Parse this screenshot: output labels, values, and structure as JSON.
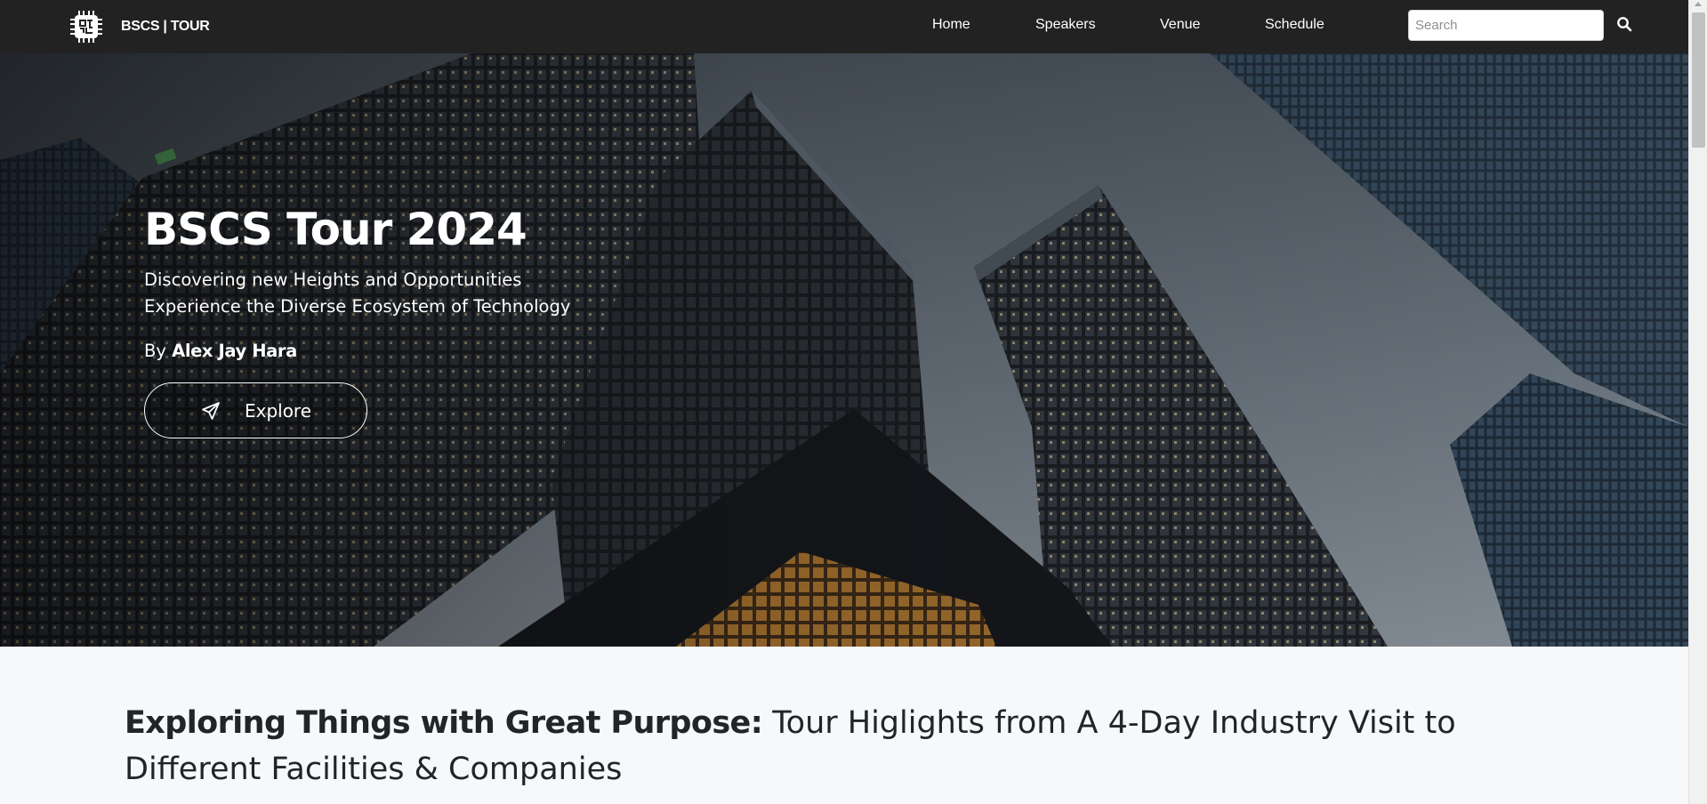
{
  "navbar": {
    "brand": {
      "text": "BSCS | TOUR",
      "icon": "cpu-chip-icon"
    },
    "links": [
      {
        "label": "Home"
      },
      {
        "label": "Speakers"
      },
      {
        "label": "Venue"
      },
      {
        "label": "Schedule"
      }
    ],
    "search": {
      "placeholder": "Search",
      "value": "",
      "icon": "search-icon"
    },
    "background_color": "#222222"
  },
  "hero": {
    "title": "BSCS Tour 2024",
    "subtitle_line1": "Discovering new Heights and Opportunities",
    "subtitle_line2": "Experience the Diverse Ecosystem of Technology",
    "by_prefix": "By",
    "author": "Alex Jay Hara",
    "button": {
      "label": "Explore",
      "icon": "paper-plane-icon"
    },
    "background_image": "city-skyscrapers-photo"
  },
  "section": {
    "heading_bold": "Exploring Things with Great Purpose:",
    "heading_rest": " Tour Higlights from A 4-Day Industry Visit to Different Facilities & Companies"
  }
}
